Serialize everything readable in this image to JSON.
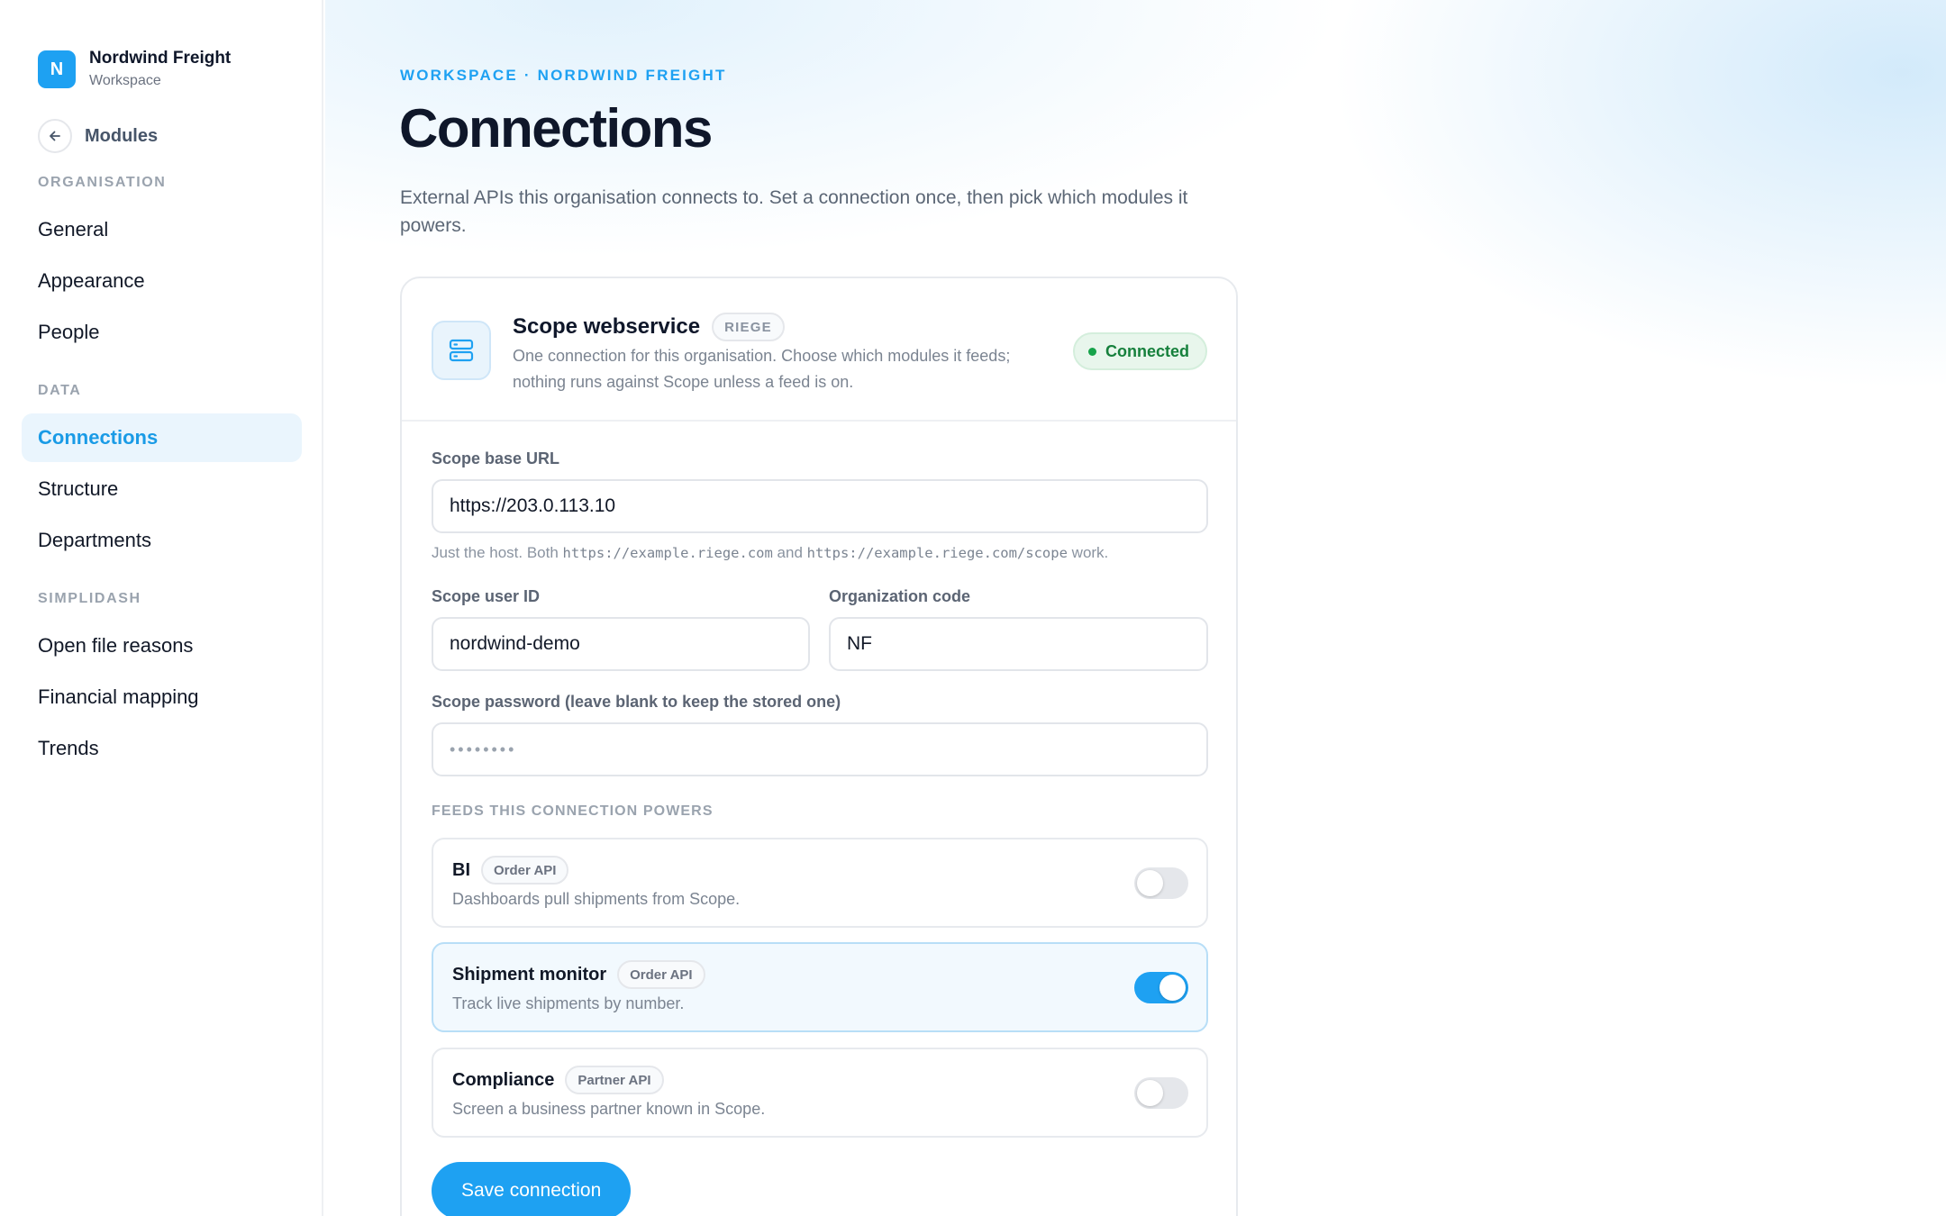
{
  "brand": {
    "initial": "N",
    "name": "Nordwind Freight",
    "subtitle": "Workspace"
  },
  "back": {
    "label": "Modules",
    "icon": "arrow-left-icon"
  },
  "sidebar": {
    "sections": [
      {
        "label": "ORGANISATION",
        "items": [
          "General",
          "Appearance",
          "People"
        ]
      },
      {
        "label": "DATA",
        "items": [
          "Connections",
          "Structure",
          "Departments"
        ]
      },
      {
        "label": "SIMPLIDASH",
        "items": [
          "Open file reasons",
          "Financial mapping",
          "Trends"
        ]
      }
    ],
    "active": "Connections"
  },
  "header": {
    "breadcrumb": "WORKSPACE · NORDWIND FREIGHT",
    "title": "Connections",
    "description": "External APIs this organisation connects to. Set a connection once, then pick which modules it powers."
  },
  "card": {
    "icon": "server-icon",
    "title": "Scope webservice",
    "tag": "RIEGE",
    "description": "One connection for this organisation. Choose which modules it feeds; nothing runs against Scope unless a feed is on.",
    "status": "Connected",
    "status_color": "#16803c"
  },
  "form": {
    "base_url": {
      "label": "Scope base URL",
      "value": "https://203.0.113.10",
      "hint_prefix": "Just the host. Both ",
      "hint_code_1": "https://example.riege.com",
      "hint_mid": " and ",
      "hint_code_2": "https://example.riege.com/scope",
      "hint_suffix": " work."
    },
    "user_id": {
      "label": "Scope user ID",
      "value": "nordwind-demo"
    },
    "org_code": {
      "label": "Organization code",
      "value": "NF"
    },
    "password": {
      "label": "Scope password (leave blank to keep the stored one)",
      "value": "••••••••"
    }
  },
  "feeds": {
    "label": "FEEDS THIS CONNECTION POWERS",
    "items": [
      {
        "name": "BI",
        "tag": "Order API",
        "description": "Dashboards pull shipments from Scope.",
        "enabled": false
      },
      {
        "name": "Shipment monitor",
        "tag": "Order API",
        "description": "Track live shipments by number.",
        "enabled": true
      },
      {
        "name": "Compliance",
        "tag": "Partner API",
        "description": "Screen a business partner known in Scope.",
        "enabled": false
      }
    ]
  },
  "actions": {
    "save_label": "Save connection"
  },
  "colors": {
    "accent": "#1ea1f2",
    "success": "#16a34a"
  }
}
